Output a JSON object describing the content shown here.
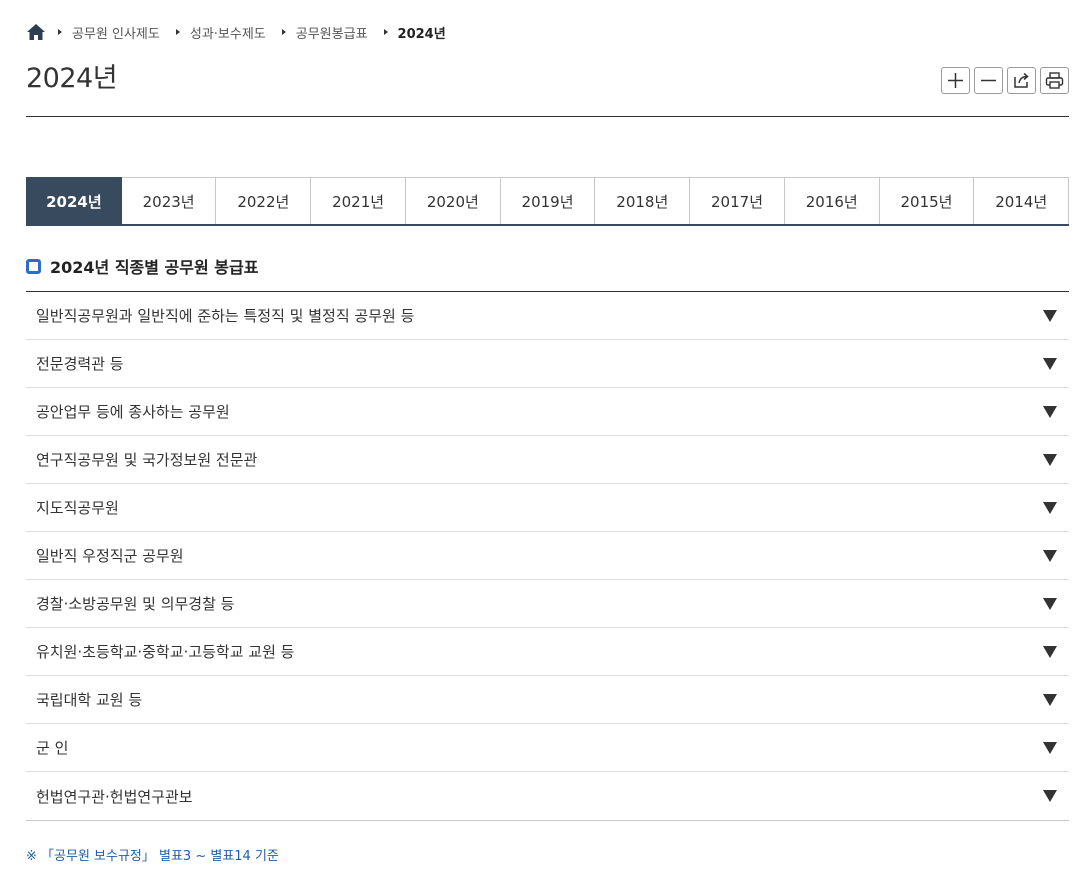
{
  "breadcrumb": {
    "items": [
      "공무원 인사제도",
      "성과·보수제도",
      "공무원봉급표"
    ],
    "current": "2024년"
  },
  "page": {
    "title": "2024년"
  },
  "tools": {
    "icons": [
      "plus-icon",
      "minus-icon",
      "share-icon",
      "print-icon"
    ]
  },
  "tabs": [
    "2024년",
    "2023년",
    "2022년",
    "2021년",
    "2020년",
    "2019년",
    "2018년",
    "2017년",
    "2016년",
    "2015년",
    "2014년"
  ],
  "section": {
    "title": "2024년 직종별 공무원 봉급표"
  },
  "accordion": [
    "일반직공무원과 일반직에 준하는 특정직 및 별정직 공무원 등",
    "전문경력관 등",
    "공안업무 등에 종사하는 공무원",
    "연구직공무원 및 국가정보원 전문관",
    "지도직공무원",
    "일반직 우정직군 공무원",
    "경찰·소방공무원 및 의무경찰 등",
    "유치원·초등학교·중학교·고등학교 교원 등",
    "국립대학 교원 등",
    "군 인",
    "헌법연구관·헌법연구관보"
  ],
  "note": "※ 「공무원 보수규정」 별표3 ~ 별표14 기준",
  "colors": {
    "active_tab": "#384a5e",
    "accent_blue": "#2b6cc4",
    "note_text": "#1f5fa8"
  }
}
